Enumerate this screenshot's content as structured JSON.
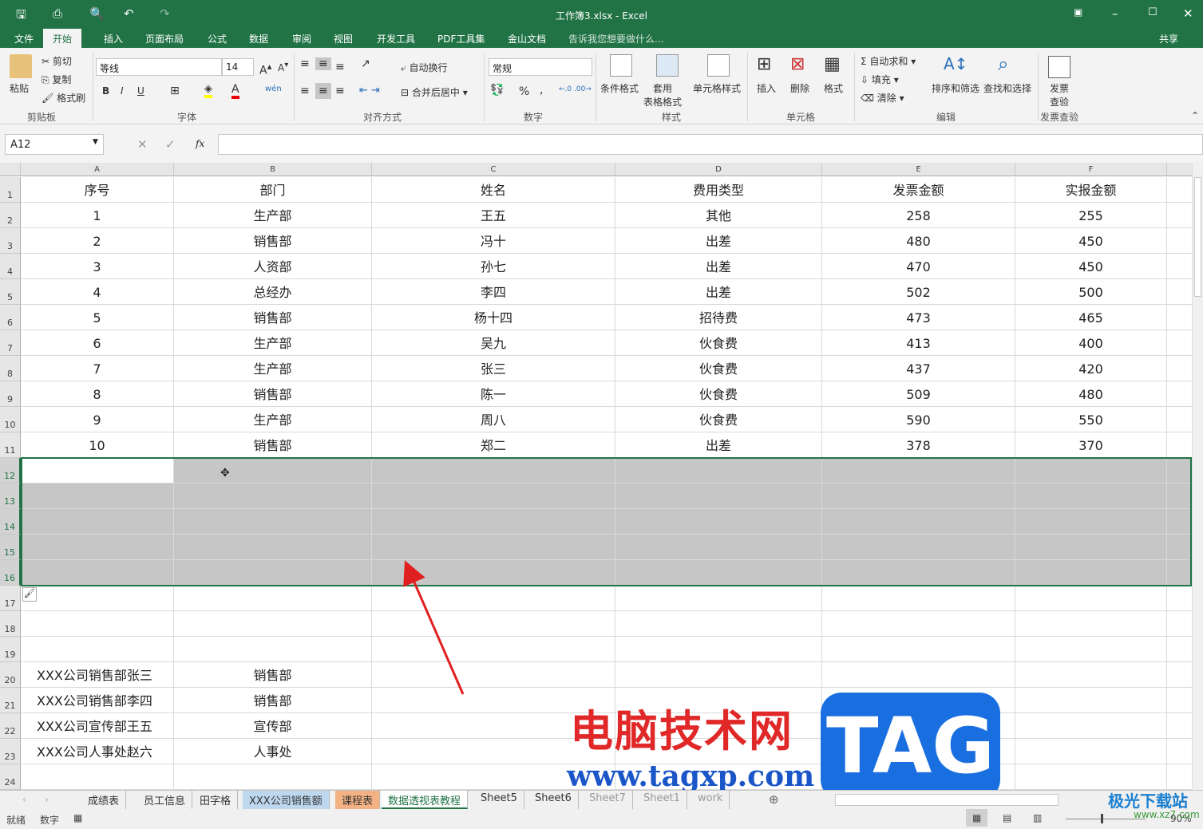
{
  "window": {
    "title": "工作簿3.xlsx - Excel"
  },
  "menu": {
    "items": [
      "文件",
      "开始",
      "插入",
      "页面布局",
      "公式",
      "数据",
      "审阅",
      "视图",
      "开发工具",
      "PDF工具集",
      "金山文档"
    ],
    "active": 1,
    "tell_me": "告诉我您想要做什么...",
    "share": "共享"
  },
  "ribbon": {
    "clipboard": {
      "paste": "粘贴",
      "cut": "剪切",
      "copy": "复制",
      "format_painter": "格式刷",
      "label": "剪贴板"
    },
    "font": {
      "name": "等线",
      "size": "14",
      "label": "字体",
      "bold": "B",
      "italic": "I",
      "underline": "U"
    },
    "align": {
      "wrap": "自动换行",
      "merge": "合并后居中",
      "label": "对齐方式"
    },
    "number": {
      "format": "常规",
      "label": "数字",
      "percent": "%",
      "comma": ","
    },
    "styles": {
      "conditional": "条件格式",
      "table": "套用\n表格格式",
      "cell": "单元格样式",
      "label": "样式"
    },
    "cells": {
      "insert": "插入",
      "delete": "删除",
      "format": "格式",
      "label": "单元格"
    },
    "editing": {
      "autosum": "自动求和",
      "fill": "填充",
      "clear": "清除",
      "sort": "排序和筛选",
      "find": "查找和选择",
      "label": "编辑"
    },
    "invoice": {
      "check": "发票\n查验",
      "label": "发票查验"
    }
  },
  "formula_bar": {
    "name_box": "A12",
    "fx": "fx",
    "value": ""
  },
  "columns": [
    "A",
    "B",
    "C",
    "D",
    "E",
    "F",
    ""
  ],
  "rows": [
    [
      "序号",
      "部门",
      "姓名",
      "费用类型",
      "发票金额",
      "实报金额"
    ],
    [
      "1",
      "生产部",
      "王五",
      "其他",
      "258",
      "255"
    ],
    [
      "2",
      "销售部",
      "冯十",
      "出差",
      "480",
      "450"
    ],
    [
      "3",
      "人资部",
      "孙七",
      "出差",
      "470",
      "450"
    ],
    [
      "4",
      "总经办",
      "李四",
      "出差",
      "502",
      "500"
    ],
    [
      "5",
      "销售部",
      "杨十四",
      "招待费",
      "473",
      "465"
    ],
    [
      "6",
      "生产部",
      "吴九",
      "伙食费",
      "413",
      "400"
    ],
    [
      "7",
      "生产部",
      "张三",
      "伙食费",
      "437",
      "420"
    ],
    [
      "8",
      "销售部",
      "陈一",
      "伙食费",
      "509",
      "480"
    ],
    [
      "9",
      "生产部",
      "周八",
      "伙食费",
      "590",
      "550"
    ],
    [
      "10",
      "销售部",
      "郑二",
      "出差",
      "378",
      "370"
    ],
    [
      "",
      "",
      "",
      "",
      "",
      ""
    ],
    [
      "",
      "",
      "",
      "",
      "",
      ""
    ],
    [
      "",
      "",
      "",
      "",
      "",
      ""
    ],
    [
      "",
      "",
      "",
      "",
      "",
      ""
    ],
    [
      "",
      "",
      "",
      "",
      "",
      ""
    ],
    [
      "",
      "",
      "",
      "",
      "",
      ""
    ],
    [
      "",
      "",
      "",
      "",
      "",
      ""
    ],
    [
      "",
      "",
      "",
      "",
      "",
      ""
    ],
    [
      "XXX公司销售部张三",
      "销售部",
      "",
      "",
      "",
      ""
    ],
    [
      "XXX公司销售部李四",
      "销售部",
      "",
      "",
      "",
      ""
    ],
    [
      "XXX公司宣传部王五",
      "宣传部",
      "",
      "",
      "",
      ""
    ],
    [
      "XXX公司人事处赵六",
      "人事处",
      "",
      "",
      "",
      ""
    ],
    [
      "",
      "",
      "",
      "",
      "",
      ""
    ]
  ],
  "selected_rows": [
    12,
    16
  ],
  "sheets": [
    {
      "name": "成绩表"
    },
    {
      "name": "员工信息"
    },
    {
      "name": "田字格"
    },
    {
      "name": "XXX公司销售额",
      "color": "#bdd7ee"
    },
    {
      "name": "课程表",
      "color": "#f4b183"
    },
    {
      "name": "数据透视表教程",
      "active": true
    },
    {
      "name": "Sheet5"
    },
    {
      "name": "Sheet6"
    },
    {
      "name": "Sheet7"
    },
    {
      "name": "Sheet1"
    },
    {
      "name": "work"
    }
  ],
  "status": {
    "ready": "就绪",
    "mode": "数字",
    "zoom": "90%"
  },
  "watermark": {
    "site_cn": "电脑技术网",
    "site_url": "www.tagxp.com",
    "tag": "TAG",
    "corner": "极光下载站",
    "corner_url": "www.xz7.com"
  },
  "colors": {
    "accent": "#217346",
    "selection": "#c6c6c6",
    "arrow": "#e02020",
    "tag": "#1a6fe0"
  }
}
